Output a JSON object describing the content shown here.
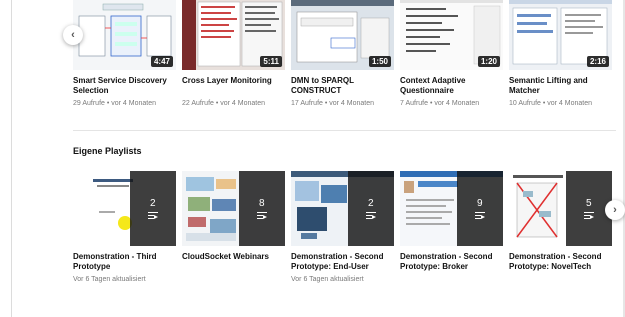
{
  "videos": [
    {
      "title": "Smart Service Discovery Selection",
      "meta": "29 Aufrufe • vor 4 Monaten",
      "duration": "4:47"
    },
    {
      "title": "Cross Layer Monitoring",
      "meta": "22 Aufrufe • vor 4 Monaten",
      "duration": "5:11"
    },
    {
      "title": "DMN to SPARQL CONSTRUCT",
      "meta": "17 Aufrufe • vor 4 Monaten",
      "duration": "1:50"
    },
    {
      "title": "Context Adaptive Questionnaire",
      "meta": "7 Aufrufe • vor 4 Monaten",
      "duration": "1:20"
    },
    {
      "title": "Semantic Lifting and Matcher",
      "meta": "10 Aufrufe • vor 4 Monaten",
      "duration": "2:16"
    }
  ],
  "playlists_section": {
    "title": "Eigene Playlists"
  },
  "playlists": [
    {
      "title": "Demonstration - Third Prototype",
      "meta": "Vor 6 Tagen aktualisiert",
      "count": "2"
    },
    {
      "title": "CloudSocket Webinars",
      "meta": "",
      "count": "8"
    },
    {
      "title": "Demonstration - Second Prototype: End-User",
      "meta": "Vor 6 Tagen aktualisiert",
      "count": "2"
    },
    {
      "title": "Demonstration - Second Prototype: Broker",
      "meta": "",
      "count": "9"
    },
    {
      "title": "Demonstration - Second Prototype: NovelTech",
      "meta": "",
      "count": "5"
    }
  ],
  "nav": {
    "prev": "‹",
    "next": "›"
  }
}
